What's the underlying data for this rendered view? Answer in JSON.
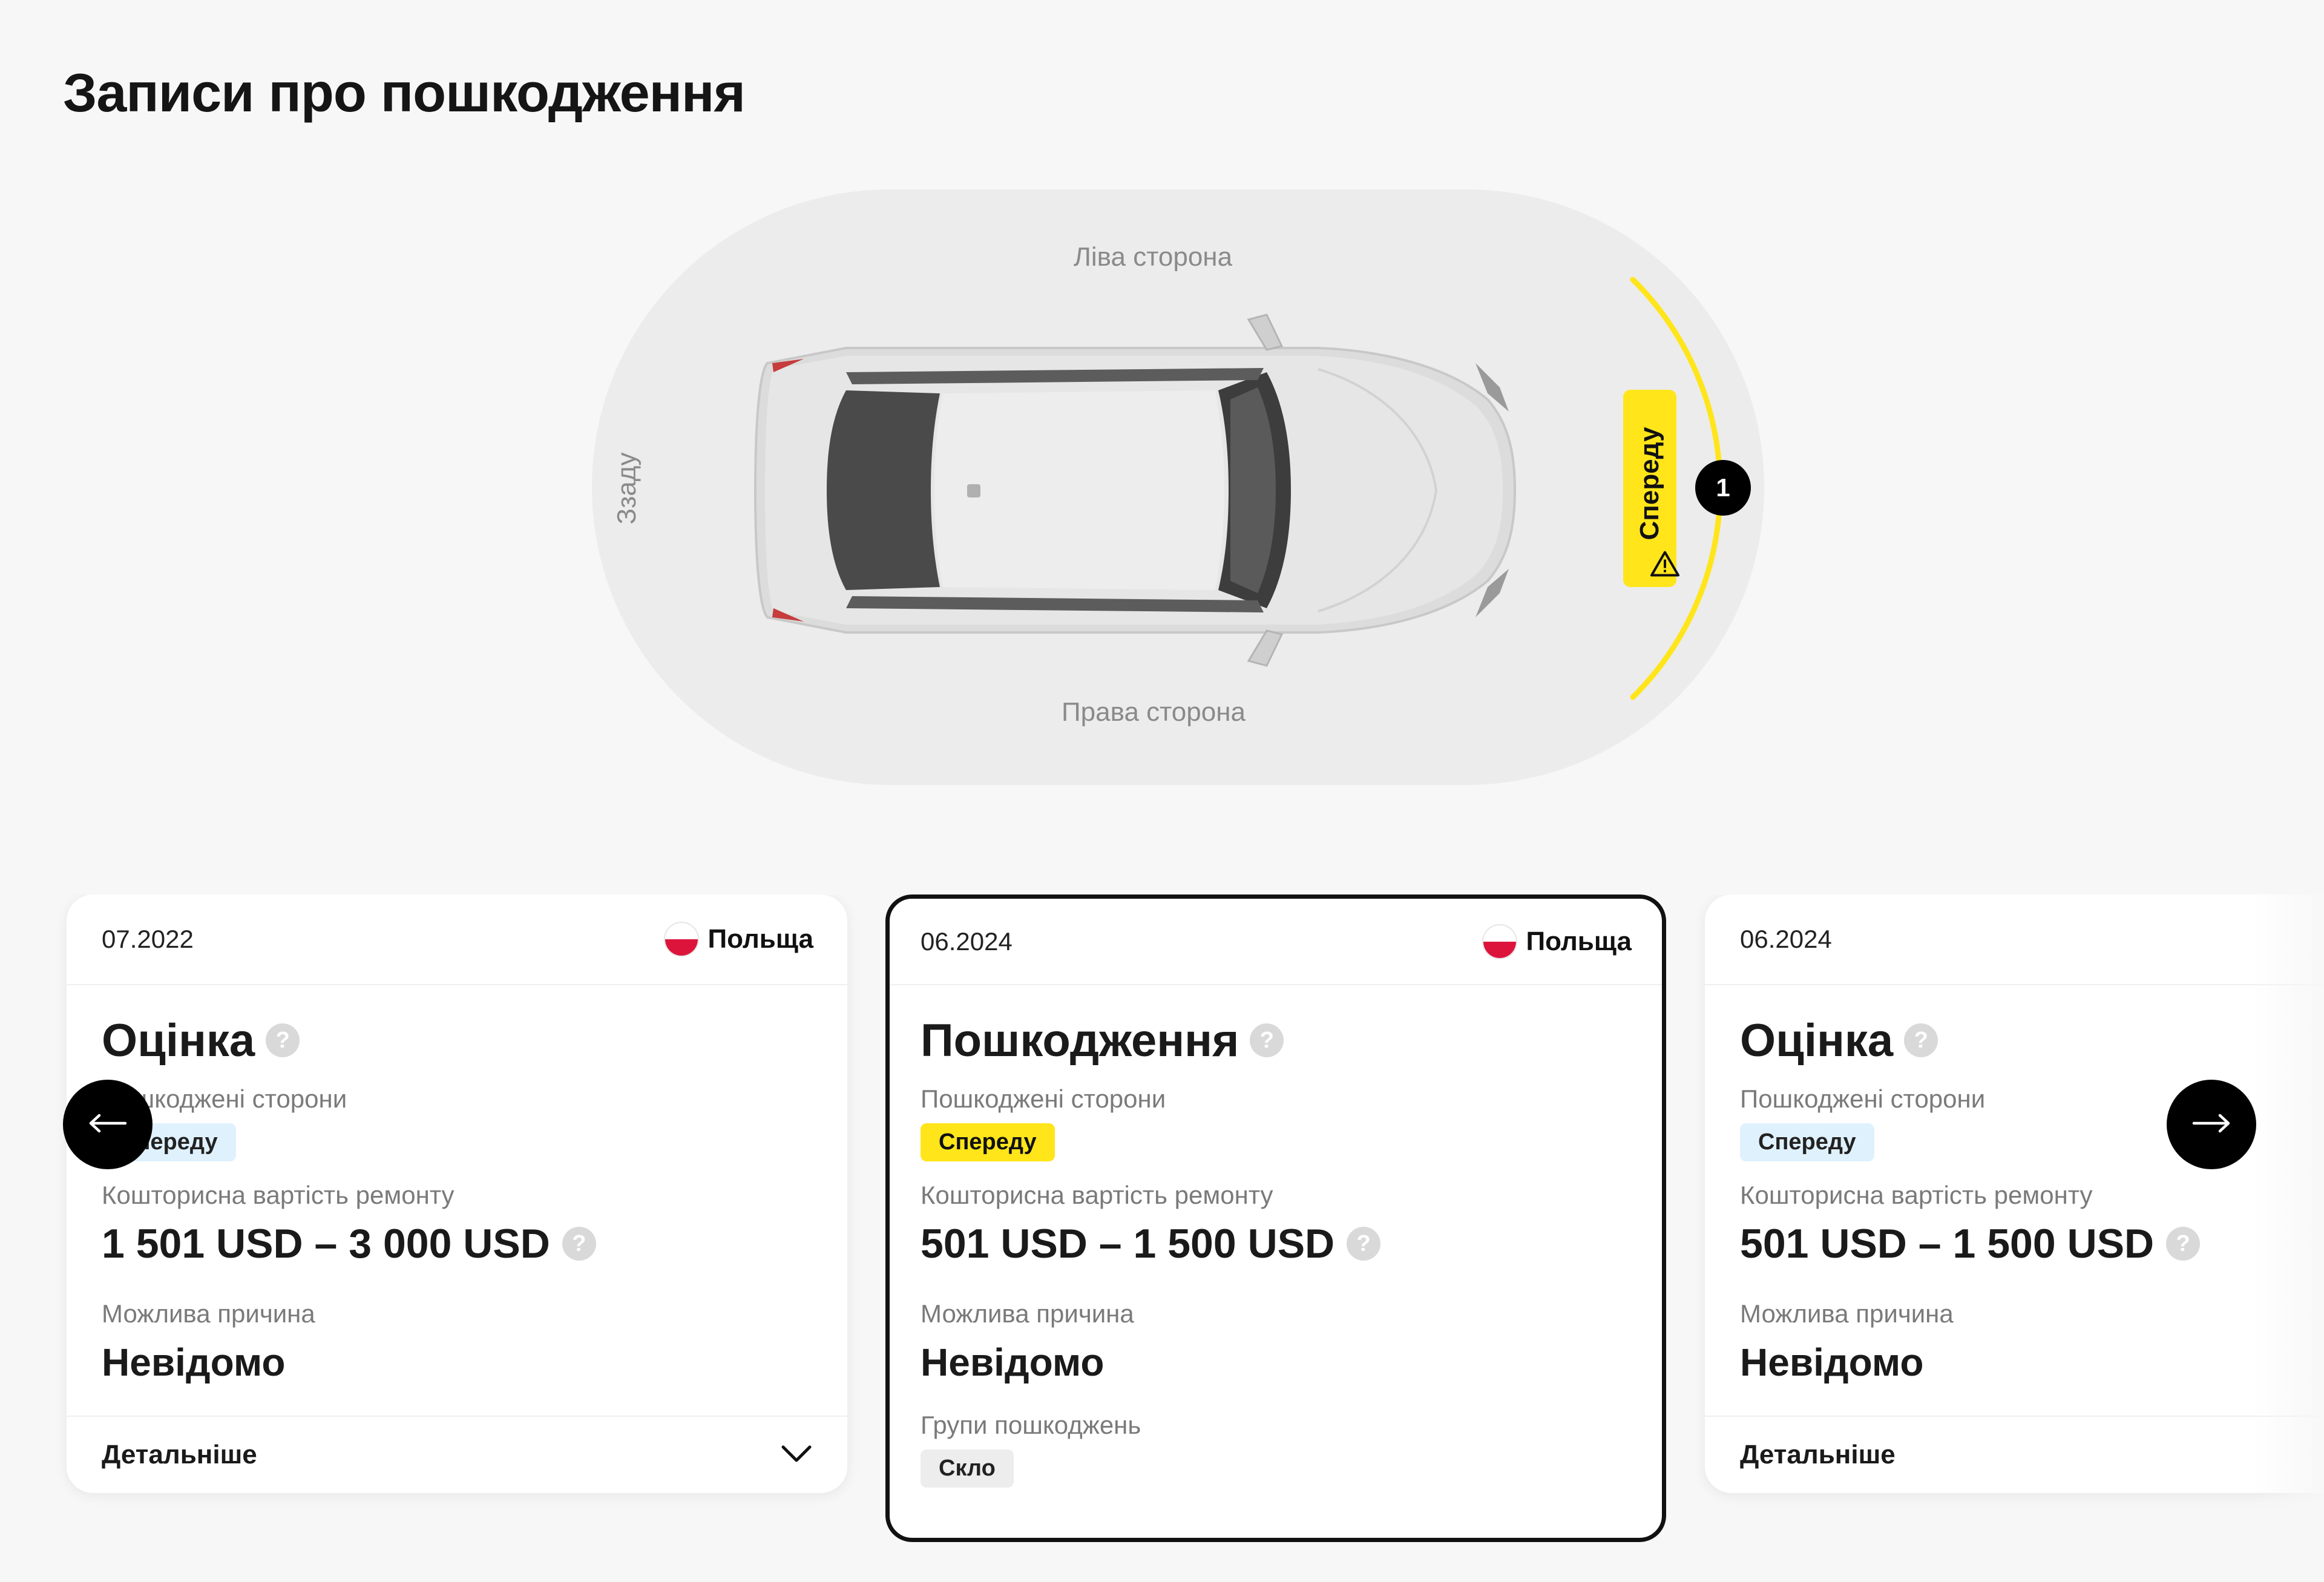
{
  "page": {
    "title": "Записи про пошкодження"
  },
  "diagram": {
    "left_side_label": "Ліва сторона",
    "right_side_label": "Права сторона",
    "rear_label": "Ззаду",
    "front_badge_label": "Спереду",
    "front_count": "1",
    "highlight_color": "#ffe51a",
    "warning_icon": "warning-triangle-icon"
  },
  "navigation": {
    "prev_icon": "arrow-left-icon",
    "next_icon": "arrow-right-icon"
  },
  "cards": [
    {
      "date": "07.2022",
      "country": "Польща",
      "title": "Оцінка",
      "damaged_sides_label": "Пошкоджені сторони",
      "damaged_sides": [
        "Спереду"
      ],
      "cost_label": "Кошторисна вартість ремонту",
      "cost": "1 501 USD – 3 000 USD",
      "cause_label": "Можлива причина",
      "cause": "Невідомо",
      "details_label": "Детальніше"
    },
    {
      "date": "06.2024",
      "country": "Польща",
      "title": "Пошкодження",
      "damaged_sides_label": "Пошкоджені сторони",
      "damaged_sides": [
        "Спереду"
      ],
      "cost_label": "Кошторисна вартість ремонту",
      "cost": "501 USD – 1 500 USD",
      "cause_label": "Можлива причина",
      "cause": "Невідомо",
      "groups_label": "Групи пошкоджень",
      "groups": [
        "Скло"
      ]
    },
    {
      "date": "06.2024",
      "title": "Оцінка",
      "damaged_sides_label": "Пошкоджені сторони",
      "damaged_sides": [
        "Спереду"
      ],
      "cost_label": "Кошторисна вартість ремонту",
      "cost": "501 USD – 1 500 USD",
      "cause_label": "Можлива причина",
      "cause": "Невідомо",
      "details_label": "Детальніше"
    }
  ]
}
